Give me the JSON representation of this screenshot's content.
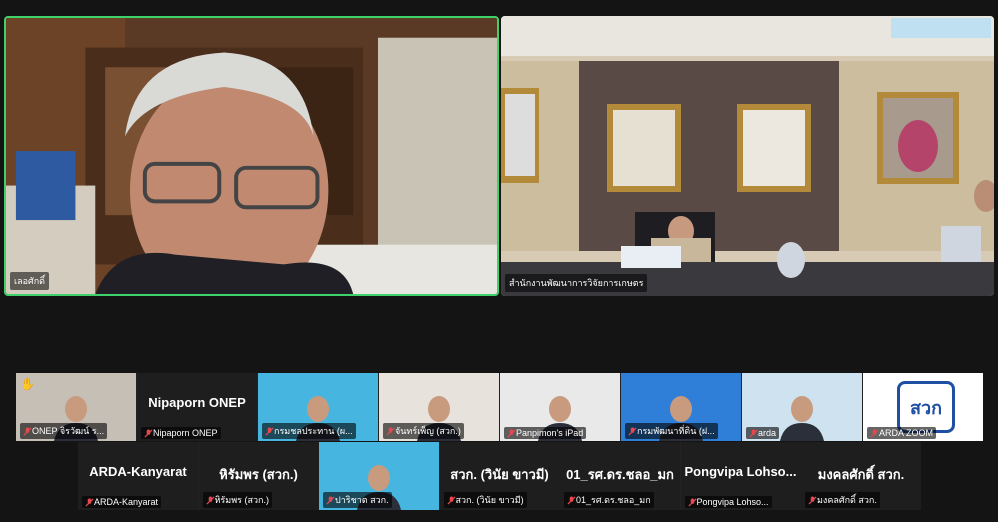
{
  "main": {
    "left_tile_name": "เลอศักดิ์",
    "right_tile_name": "สำนักงานพัฒนาการวิจัยการเกษตร"
  },
  "strip_1": [
    {
      "big": "",
      "label": "ONEP จิรวัฒน์ ร...",
      "kind": "video",
      "hand": true
    },
    {
      "big": "Nipaporn ONEP",
      "label": "Nipaporn ONEP",
      "kind": "text"
    },
    {
      "big": "",
      "label": "กรมชลประทาน (ผ...",
      "kind": "video"
    },
    {
      "big": "",
      "label": "จันทร์เพ็ญ (สวก.)",
      "kind": "video"
    },
    {
      "big": "",
      "label": "Panpimon's iPad",
      "kind": "video"
    },
    {
      "big": "",
      "label": "กรมพัฒนาที่ดิน (ฝ...",
      "kind": "video"
    },
    {
      "big": "",
      "label": "arda",
      "kind": "video"
    },
    {
      "big": "",
      "label": "ARDA ZOOM",
      "kind": "logo",
      "logo_text": "สวก"
    }
  ],
  "strip_2": [
    {
      "big": "ARDA-Kanyarat",
      "label": "ARDA-Kanyarat",
      "kind": "text"
    },
    {
      "big": "หิรัมพร (สวก.)",
      "label": "หิรัมพร (สวก.)",
      "kind": "text"
    },
    {
      "big": "",
      "label": "ปาริชาต สวก.",
      "kind": "video"
    },
    {
      "big": "สวก. (วินัย ขาวมี)",
      "label": "สวก. (วินัย ขาวมี)",
      "kind": "text"
    },
    {
      "big": "01_รศ.ดร.ชลอ_มก",
      "label": "01_รศ.ดร.ชลอ_มก",
      "kind": "text"
    },
    {
      "big": "Pongvipa Lohso...",
      "label": "Pongvipa Lohso...",
      "kind": "text"
    },
    {
      "big": "มงคลศักดิ์ สวก.",
      "label": "มงคลศักดิ์ สวก.",
      "kind": "text"
    }
  ],
  "colors": {
    "active_speaker_border": "#3fd16a",
    "muted_icon": "#e5484d",
    "background": "#141414"
  },
  "icons": {
    "muted": "mic-off-icon",
    "raised_hand": "raise-hand-icon"
  }
}
